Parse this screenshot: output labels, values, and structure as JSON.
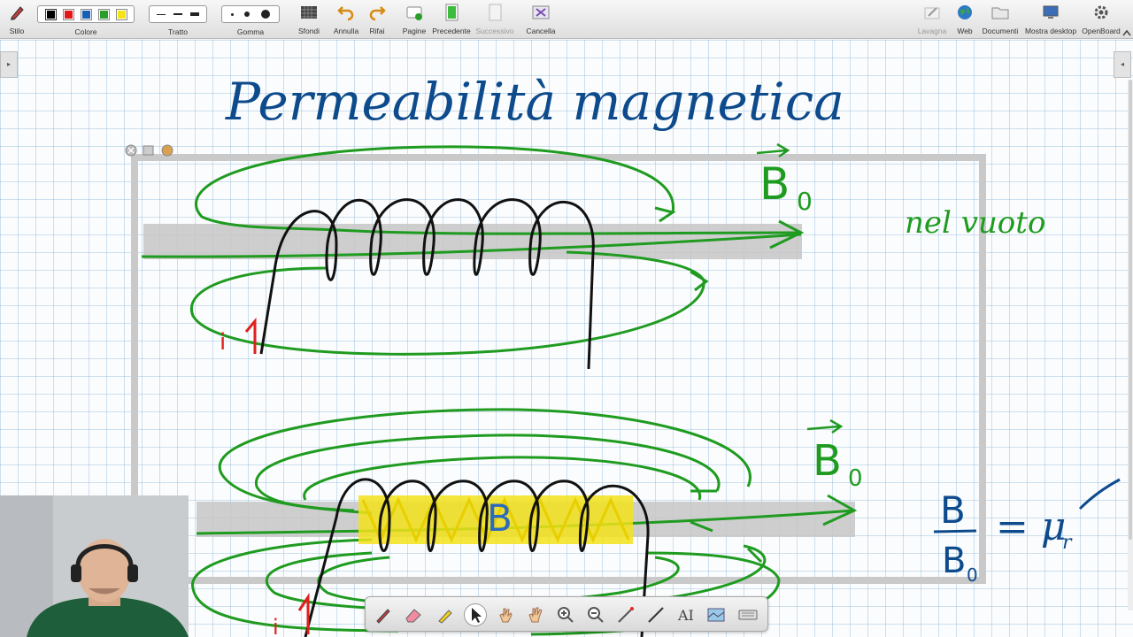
{
  "toolbar": {
    "stilo": "Stilo",
    "colore": "Colore",
    "tratto": "Tratto",
    "gomma": "Gomma",
    "sfondi": "Sfondi",
    "annulla": "Annulla",
    "rifai": "Rifai",
    "pagine": "Pagine",
    "precedente": "Precedente",
    "successivo": "Successivo",
    "cancella": "Cancella",
    "lavagna": "Lavagna",
    "web": "Web",
    "documenti": "Documenti",
    "mostra_desktop": "Mostra desktop",
    "openboard": "OpenBoard"
  },
  "palette": [
    "#000000",
    "#e01818",
    "#1a5fb4",
    "#2a9d2a",
    "#f2e418"
  ],
  "board": {
    "title_text": "Permeabilità magnetica",
    "b0_label_top": "B",
    "b0_sub_top": "0",
    "vuoto_text": "nel vuoto",
    "current_label_top": "i",
    "b_label_core": "B",
    "b0_label_bottom": "B",
    "b0_sub_bottom": "0",
    "ratio_num": "B",
    "ratio_den": "B",
    "ratio_den_sub": "0",
    "ratio_eq": "= μ",
    "ratio_sub": "r",
    "current_label_bottom": "i"
  },
  "colors": {
    "ink_blue": "#0d4b8c",
    "ink_green": "#1f9b20",
    "ink_red": "#e0201c",
    "ink_black": "#111111",
    "highlight_yellow": "#f2e21a"
  }
}
